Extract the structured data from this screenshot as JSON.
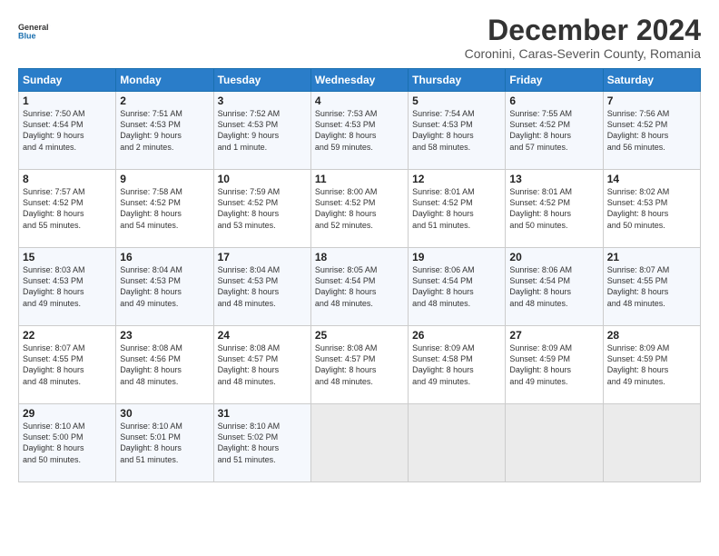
{
  "logo": {
    "line1": "General",
    "line2": "Blue"
  },
  "title": "December 2024",
  "subtitle": "Coronini, Caras-Severin County, Romania",
  "header_days": [
    "Sunday",
    "Monday",
    "Tuesday",
    "Wednesday",
    "Thursday",
    "Friday",
    "Saturday"
  ],
  "weeks": [
    [
      {
        "day": "1",
        "info": "Sunrise: 7:50 AM\nSunset: 4:54 PM\nDaylight: 9 hours\nand 4 minutes."
      },
      {
        "day": "2",
        "info": "Sunrise: 7:51 AM\nSunset: 4:53 PM\nDaylight: 9 hours\nand 2 minutes."
      },
      {
        "day": "3",
        "info": "Sunrise: 7:52 AM\nSunset: 4:53 PM\nDaylight: 9 hours\nand 1 minute."
      },
      {
        "day": "4",
        "info": "Sunrise: 7:53 AM\nSunset: 4:53 PM\nDaylight: 8 hours\nand 59 minutes."
      },
      {
        "day": "5",
        "info": "Sunrise: 7:54 AM\nSunset: 4:53 PM\nDaylight: 8 hours\nand 58 minutes."
      },
      {
        "day": "6",
        "info": "Sunrise: 7:55 AM\nSunset: 4:52 PM\nDaylight: 8 hours\nand 57 minutes."
      },
      {
        "day": "7",
        "info": "Sunrise: 7:56 AM\nSunset: 4:52 PM\nDaylight: 8 hours\nand 56 minutes."
      }
    ],
    [
      {
        "day": "8",
        "info": "Sunrise: 7:57 AM\nSunset: 4:52 PM\nDaylight: 8 hours\nand 55 minutes."
      },
      {
        "day": "9",
        "info": "Sunrise: 7:58 AM\nSunset: 4:52 PM\nDaylight: 8 hours\nand 54 minutes."
      },
      {
        "day": "10",
        "info": "Sunrise: 7:59 AM\nSunset: 4:52 PM\nDaylight: 8 hours\nand 53 minutes."
      },
      {
        "day": "11",
        "info": "Sunrise: 8:00 AM\nSunset: 4:52 PM\nDaylight: 8 hours\nand 52 minutes."
      },
      {
        "day": "12",
        "info": "Sunrise: 8:01 AM\nSunset: 4:52 PM\nDaylight: 8 hours\nand 51 minutes."
      },
      {
        "day": "13",
        "info": "Sunrise: 8:01 AM\nSunset: 4:52 PM\nDaylight: 8 hours\nand 50 minutes."
      },
      {
        "day": "14",
        "info": "Sunrise: 8:02 AM\nSunset: 4:53 PM\nDaylight: 8 hours\nand 50 minutes."
      }
    ],
    [
      {
        "day": "15",
        "info": "Sunrise: 8:03 AM\nSunset: 4:53 PM\nDaylight: 8 hours\nand 49 minutes."
      },
      {
        "day": "16",
        "info": "Sunrise: 8:04 AM\nSunset: 4:53 PM\nDaylight: 8 hours\nand 49 minutes."
      },
      {
        "day": "17",
        "info": "Sunrise: 8:04 AM\nSunset: 4:53 PM\nDaylight: 8 hours\nand 48 minutes."
      },
      {
        "day": "18",
        "info": "Sunrise: 8:05 AM\nSunset: 4:54 PM\nDaylight: 8 hours\nand 48 minutes."
      },
      {
        "day": "19",
        "info": "Sunrise: 8:06 AM\nSunset: 4:54 PM\nDaylight: 8 hours\nand 48 minutes."
      },
      {
        "day": "20",
        "info": "Sunrise: 8:06 AM\nSunset: 4:54 PM\nDaylight: 8 hours\nand 48 minutes."
      },
      {
        "day": "21",
        "info": "Sunrise: 8:07 AM\nSunset: 4:55 PM\nDaylight: 8 hours\nand 48 minutes."
      }
    ],
    [
      {
        "day": "22",
        "info": "Sunrise: 8:07 AM\nSunset: 4:55 PM\nDaylight: 8 hours\nand 48 minutes."
      },
      {
        "day": "23",
        "info": "Sunrise: 8:08 AM\nSunset: 4:56 PM\nDaylight: 8 hours\nand 48 minutes."
      },
      {
        "day": "24",
        "info": "Sunrise: 8:08 AM\nSunset: 4:57 PM\nDaylight: 8 hours\nand 48 minutes."
      },
      {
        "day": "25",
        "info": "Sunrise: 8:08 AM\nSunset: 4:57 PM\nDaylight: 8 hours\nand 48 minutes."
      },
      {
        "day": "26",
        "info": "Sunrise: 8:09 AM\nSunset: 4:58 PM\nDaylight: 8 hours\nand 49 minutes."
      },
      {
        "day": "27",
        "info": "Sunrise: 8:09 AM\nSunset: 4:59 PM\nDaylight: 8 hours\nand 49 minutes."
      },
      {
        "day": "28",
        "info": "Sunrise: 8:09 AM\nSunset: 4:59 PM\nDaylight: 8 hours\nand 49 minutes."
      }
    ],
    [
      {
        "day": "29",
        "info": "Sunrise: 8:10 AM\nSunset: 5:00 PM\nDaylight: 8 hours\nand 50 minutes."
      },
      {
        "day": "30",
        "info": "Sunrise: 8:10 AM\nSunset: 5:01 PM\nDaylight: 8 hours\nand 51 minutes."
      },
      {
        "day": "31",
        "info": "Sunrise: 8:10 AM\nSunset: 5:02 PM\nDaylight: 8 hours\nand 51 minutes."
      },
      {
        "day": "",
        "info": ""
      },
      {
        "day": "",
        "info": ""
      },
      {
        "day": "",
        "info": ""
      },
      {
        "day": "",
        "info": ""
      }
    ]
  ]
}
